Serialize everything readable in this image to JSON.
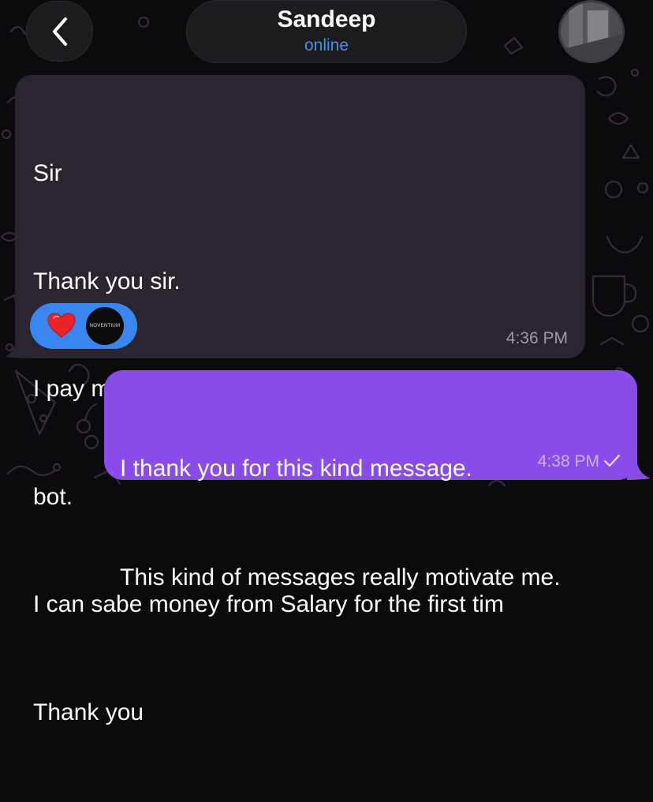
{
  "header": {
    "contact_name": "Sandeep",
    "status": "online"
  },
  "messages": {
    "incoming": {
      "lines": [
        "Sir",
        "Thank you sir.",
        "I pay my rent today with money from your",
        "bot.",
        "I can sabe money from Salary for the first tim",
        "Thank you"
      ],
      "time": "4:36 PM",
      "reactions": {
        "emoji_icon": "heart-icon",
        "reactor_avatar_text": "NOVENTIUM"
      }
    },
    "outgoing": {
      "lines": [
        "I thank you for this kind message.",
        "This kind of messages really motivate me."
      ],
      "time": "4:38 PM",
      "status_icon": "single-check-icon"
    }
  },
  "colors": {
    "background": "#0b0a0d",
    "incoming_bubble": "#2a2530",
    "outgoing_bubble": "#8a4ce8",
    "status_blue": "#4a8ff0",
    "reaction_pill": "#3a86f0"
  }
}
